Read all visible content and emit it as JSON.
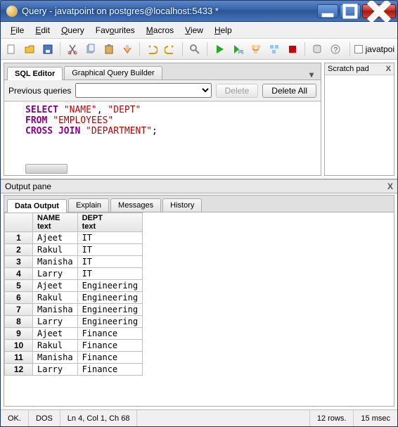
{
  "window": {
    "title": "Query - javatpoint on postgres@localhost:5433 *"
  },
  "menu": {
    "file": "File",
    "edit": "Edit",
    "query": "Query",
    "favourites": "Favourites",
    "macros": "Macros",
    "view": "View",
    "help": "Help",
    "shortcut_label": "javatpoi"
  },
  "editor": {
    "tab_sql": "SQL Editor",
    "tab_gqb": "Graphical Query Builder",
    "prev_label": "Previous queries",
    "delete_btn": "Delete",
    "delete_all_btn": "Delete All",
    "code_kw1": "SELECT",
    "code_str1": "\"NAME\"",
    "code_comma": ", ",
    "code_str2": "\"DEPT\"",
    "code_kw2": "FROM",
    "code_str3": "\"EMPLOYEES\"",
    "code_kw3": "CROSS",
    "code_kw4": "JOIN",
    "code_str4": "\"DEPARTMENT\"",
    "code_semicolon": ";"
  },
  "scratch": {
    "title": "Scratch pad"
  },
  "output": {
    "pane_title": "Output pane",
    "tab_data": "Data Output",
    "tab_explain": "Explain",
    "tab_messages": "Messages",
    "tab_history": "History",
    "col1_name": "NAME",
    "col1_type": "text",
    "col2_name": "DEPT",
    "col2_type": "text",
    "rows": [
      {
        "n": "1",
        "name": "Ajeet",
        "dept": "IT"
      },
      {
        "n": "2",
        "name": "Rakul",
        "dept": "IT"
      },
      {
        "n": "3",
        "name": "Manisha",
        "dept": "IT"
      },
      {
        "n": "4",
        "name": "Larry",
        "dept": "IT"
      },
      {
        "n": "5",
        "name": "Ajeet",
        "dept": "Engineering"
      },
      {
        "n": "6",
        "name": "Rakul",
        "dept": "Engineering"
      },
      {
        "n": "7",
        "name": "Manisha",
        "dept": "Engineering"
      },
      {
        "n": "8",
        "name": "Larry",
        "dept": "Engineering"
      },
      {
        "n": "9",
        "name": "Ajeet",
        "dept": "Finance"
      },
      {
        "n": "10",
        "name": "Rakul",
        "dept": "Finance"
      },
      {
        "n": "11",
        "name": "Manisha",
        "dept": "Finance"
      },
      {
        "n": "12",
        "name": "Larry",
        "dept": "Finance"
      }
    ]
  },
  "status": {
    "ok": "OK.",
    "enc": "DOS",
    "pos": "Ln 4, Col 1, Ch 68",
    "rows": "12 rows.",
    "time": "15 msec"
  }
}
